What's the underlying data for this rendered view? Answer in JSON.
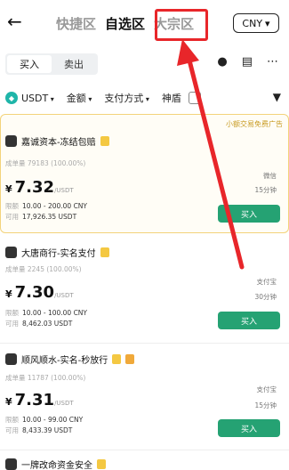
{
  "header": {
    "back_icon": "←",
    "tabs": [
      "快捷区",
      "自选区",
      "大宗区"
    ],
    "currency": "CNY"
  },
  "segment": {
    "buy": "买入",
    "sell": "卖出"
  },
  "filters": {
    "coin": "USDT",
    "amount": "金额",
    "payment": "支付方式",
    "extra": "神盾"
  },
  "banner": "小额交易免费广告",
  "offers": [
    {
      "merchant": "嘉诚资本-冻结包赔",
      "stats": "成单量 79183 (100.00%)",
      "price": "7.32",
      "unit": "/USDT",
      "limit_label": "限额",
      "limit": "10.00 - 200.00 CNY",
      "avail_label": "可用",
      "available": "17,926.35 USDT",
      "payment": "微信",
      "timer": "15分钟",
      "buy": "买入"
    },
    {
      "merchant": "大唐商行-实名支付",
      "stats": "成单量 2245 (100.00%)",
      "price": "7.30",
      "unit": "/USDT",
      "limit_label": "限额",
      "limit": "10.00 - 100.00 CNY",
      "avail_label": "可用",
      "available": "8,462.03 USDT",
      "payment": "支付宝",
      "timer": "30分钟",
      "buy": "买入"
    },
    {
      "merchant": "顺风顺水-实名-秒放行",
      "stats": "成单量 11787 (100.00%)",
      "price": "7.31",
      "unit": "/USDT",
      "limit_label": "限额",
      "limit": "10.00 - 99.00 CNY",
      "avail_label": "可用",
      "available": "8,433.39 USDT",
      "payment": "支付宝",
      "timer": "15分钟",
      "buy": "买入"
    },
    {
      "merchant": "一牌改命资金安全"
    }
  ],
  "colors": {
    "accent_green": "#25a273",
    "highlight_red": "#e8262a",
    "gold": "#f3d37b"
  }
}
